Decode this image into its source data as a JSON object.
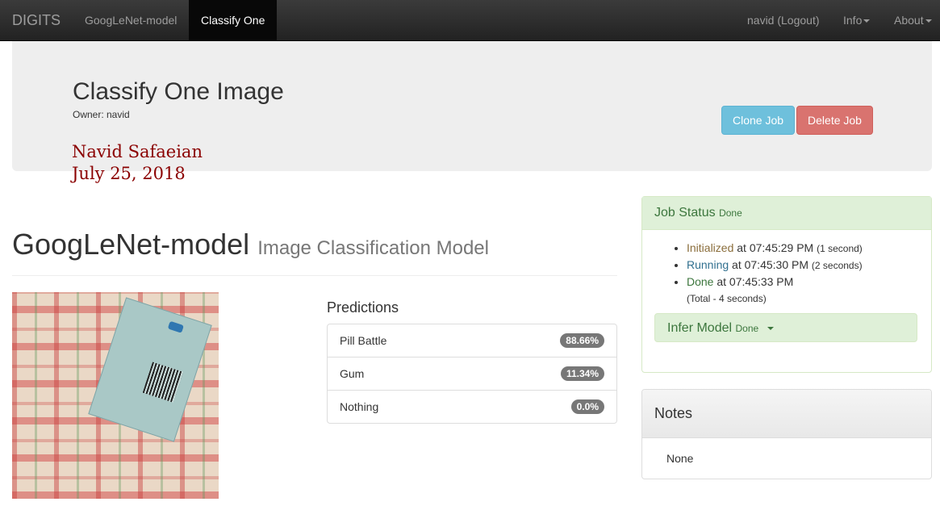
{
  "navbar": {
    "brand": "DIGITS",
    "links": [
      "GoogLeNet-model",
      "Classify One"
    ],
    "user": "navid (Logout)",
    "info": "Info",
    "about": "About"
  },
  "header": {
    "title": "Classify One Image",
    "owner": "Owner: navid",
    "signature_name": "Navid Safaeian",
    "signature_date": "July 25, 2018",
    "clone_label": "Clone Job",
    "delete_label": "Delete Job"
  },
  "model": {
    "name": "GoogLeNet-model",
    "subtitle": "Image Classification Model"
  },
  "predictions": {
    "heading": "Predictions",
    "items": [
      {
        "label": "Pill Battle",
        "value": "88.66%"
      },
      {
        "label": "Gum",
        "value": "11.34%"
      },
      {
        "label": "Nothing",
        "value": "0.0%"
      }
    ]
  },
  "job_status": {
    "title": "Job Status",
    "state": "Done",
    "entries": [
      {
        "state": "Initialized",
        "at": " at 07:45:29 PM ",
        "duration": "(1 second)"
      },
      {
        "state": "Running",
        "at": " at 07:45:30 PM ",
        "duration": "(2 seconds)"
      },
      {
        "state": "Done",
        "at": " at 07:45:33 PM",
        "duration": ""
      }
    ],
    "total": "(Total - 4 seconds)",
    "infer_label": "Infer Model",
    "infer_state": "Done"
  },
  "notes": {
    "title": "Notes",
    "body": "None"
  },
  "colors": {
    "success_bg": "#dff0d8",
    "success_text": "#3c763d",
    "info_btn": "#6ec0dc",
    "danger_btn": "#d9736f",
    "signature": "#8b0000"
  }
}
